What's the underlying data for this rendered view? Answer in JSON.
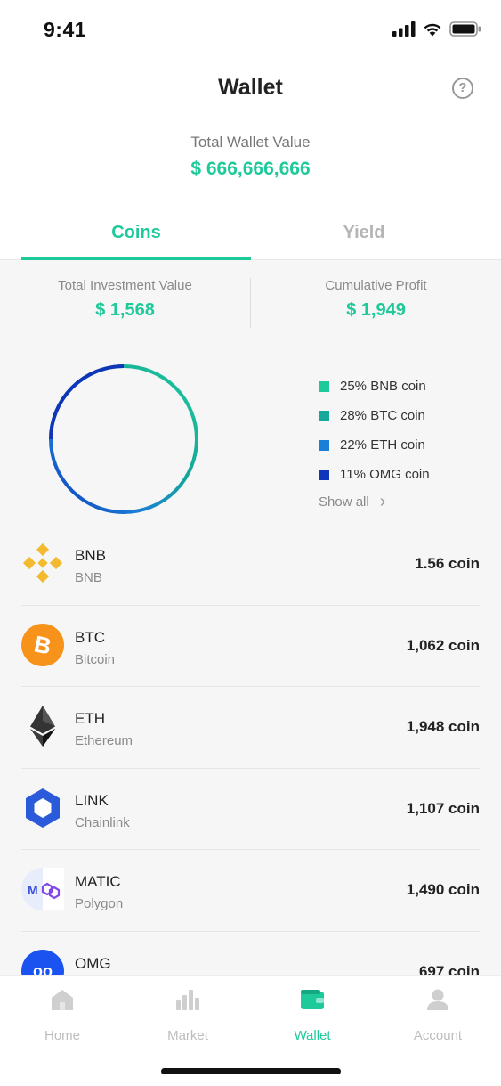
{
  "status_bar": {
    "time": "9:41"
  },
  "header": {
    "title": "Wallet",
    "help_icon": "question-circle-icon"
  },
  "wallet_total": {
    "label": "Total Wallet Value",
    "value": "$ 666,666,666"
  },
  "tabs": [
    {
      "label": "Coins",
      "active": true
    },
    {
      "label": "Yield",
      "active": false
    }
  ],
  "summary": {
    "investment": {
      "label": "Total Investment Value",
      "value": "$ 1,568"
    },
    "profit": {
      "label": "Cumulative Profit",
      "value": "$ 1,949"
    }
  },
  "allocation": {
    "legend": [
      {
        "label": "25% BNB coin",
        "color": "#1ec99a"
      },
      {
        "label": "28% BTC coin",
        "color": "#14a79a"
      },
      {
        "label": "22% ETH coin",
        "color": "#1a7fd6"
      },
      {
        "label": "11% OMG coin",
        "color": "#0f35b8"
      }
    ],
    "show_all": "Show all"
  },
  "coins": [
    {
      "symbol": "BNB",
      "name": "BNB",
      "amount": "1.56 coin",
      "icon": "bnb-icon"
    },
    {
      "symbol": "BTC",
      "name": "Bitcoin",
      "amount": "1,062 coin",
      "icon": "btc-icon"
    },
    {
      "symbol": "ETH",
      "name": "Ethereum",
      "amount": "1,948 coin",
      "icon": "eth-icon"
    },
    {
      "symbol": "LINK",
      "name": "Chainlink",
      "amount": "1,107 coin",
      "icon": "link-icon"
    },
    {
      "symbol": "MATIC",
      "name": "Polygon",
      "amount": "1,490 coin",
      "icon": "matic-icon"
    },
    {
      "symbol": "OMG",
      "name": "",
      "amount": "697 coin",
      "icon": "omg-icon"
    }
  ],
  "tabbar": [
    {
      "label": "Home",
      "icon": "home-icon",
      "active": false
    },
    {
      "label": "Market",
      "icon": "market-icon",
      "active": false
    },
    {
      "label": "Wallet",
      "icon": "wallet-icon",
      "active": true
    },
    {
      "label": "Account",
      "icon": "account-icon",
      "active": false
    }
  ],
  "colors": {
    "accent": "#1ec99a",
    "muted": "#8a8a8a"
  }
}
